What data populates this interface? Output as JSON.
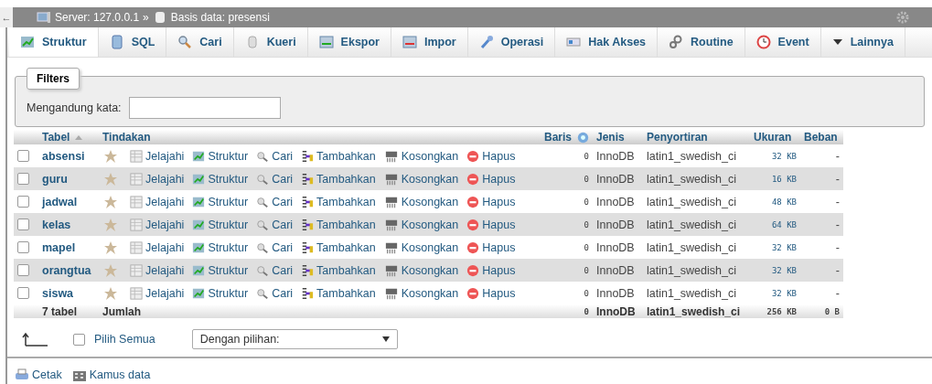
{
  "breadcrumb": {
    "back": "←",
    "server": "Server: 127.0.0.1",
    "separator": "»",
    "database": "Basis data: presensi"
  },
  "tabs": [
    {
      "label": "Struktur",
      "selected": true
    },
    {
      "label": "SQL",
      "selected": false
    },
    {
      "label": "Cari",
      "selected": false
    },
    {
      "label": "Kueri",
      "selected": false
    },
    {
      "label": "Ekspor",
      "selected": false
    },
    {
      "label": "Impor",
      "selected": false
    },
    {
      "label": "Operasi",
      "selected": false
    },
    {
      "label": "Hak Akses",
      "selected": false
    },
    {
      "label": "Routine",
      "selected": false
    },
    {
      "label": "Event",
      "selected": false
    },
    {
      "label": "Lainnya",
      "selected": false
    }
  ],
  "filters": {
    "legend": "Filters",
    "label": "Mengandung kata:"
  },
  "table": {
    "columns": [
      "Tabel",
      "Tindakan",
      "Baris",
      "Jenis",
      "Penyortiran",
      "Ukuran",
      "Beban"
    ],
    "rows": [
      {
        "checked": false,
        "favorite": false,
        "name": "absensi",
        "actions": [
          "Jelajahi",
          "Struktur",
          "Cari",
          "Tambahkan",
          "Kosongkan",
          "Hapus"
        ],
        "rows": "0",
        "engine": "InnoDB",
        "collation": "latin1_swedish_ci",
        "size": "32 KB",
        "overhead": "-"
      },
      {
        "checked": false,
        "favorite": false,
        "name": "guru",
        "actions": [
          "Jelajahi",
          "Struktur",
          "Cari",
          "Tambahkan",
          "Kosongkan",
          "Hapus"
        ],
        "rows": "0",
        "engine": "InnoDB",
        "collation": "latin1_swedish_ci",
        "size": "16 KB",
        "overhead": "-"
      },
      {
        "checked": false,
        "favorite": false,
        "name": "jadwal",
        "actions": [
          "Jelajahi",
          "Struktur",
          "Cari",
          "Tambahkan",
          "Kosongkan",
          "Hapus"
        ],
        "rows": "0",
        "engine": "InnoDB",
        "collation": "latin1_swedish_ci",
        "size": "48 KB",
        "overhead": "-"
      },
      {
        "checked": false,
        "favorite": false,
        "name": "kelas",
        "actions": [
          "Jelajahi",
          "Struktur",
          "Cari",
          "Tambahkan",
          "Kosongkan",
          "Hapus"
        ],
        "rows": "0",
        "engine": "InnoDB",
        "collation": "latin1_swedish_ci",
        "size": "64 KB",
        "overhead": "-"
      },
      {
        "checked": false,
        "favorite": false,
        "name": "mapel",
        "actions": [
          "Jelajahi",
          "Struktur",
          "Cari",
          "Tambahkan",
          "Kosongkan",
          "Hapus"
        ],
        "rows": "0",
        "engine": "InnoDB",
        "collation": "latin1_swedish_ci",
        "size": "32 KB",
        "overhead": "-"
      },
      {
        "checked": false,
        "favorite": false,
        "name": "orangtua",
        "actions": [
          "Jelajahi",
          "Struktur",
          "Cari",
          "Tambahkan",
          "Kosongkan",
          "Hapus"
        ],
        "rows": "0",
        "engine": "InnoDB",
        "collation": "latin1_swedish_ci",
        "size": "32 KB",
        "overhead": "-"
      },
      {
        "checked": false,
        "favorite": false,
        "name": "siswa",
        "actions": [
          "Jelajahi",
          "Struktur",
          "Cari",
          "Tambahkan",
          "Kosongkan",
          "Hapus"
        ],
        "rows": "0",
        "engine": "InnoDB",
        "collation": "latin1_swedish_ci",
        "size": "32 KB",
        "overhead": "-"
      }
    ],
    "footer": {
      "count": "7 tabel",
      "label": "Jumlah",
      "rows": "0",
      "engine": "InnoDB",
      "collation": "latin1_swedish_ci",
      "size": "256 KB",
      "overhead": "0 B"
    }
  },
  "bulk": {
    "select_all": {
      "label": "Pilih Semua",
      "checked": false
    },
    "with_selected": "Dengan pilihan:"
  },
  "links": [
    "Cetak",
    "Kamus data"
  ]
}
